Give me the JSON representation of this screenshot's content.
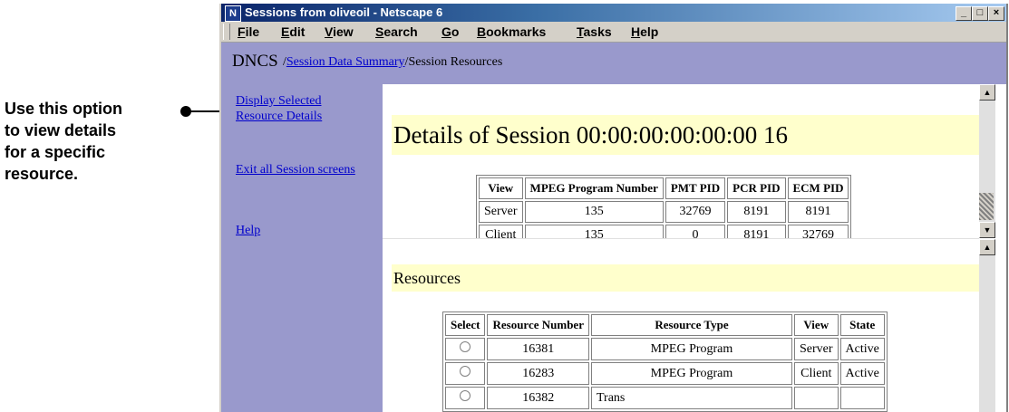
{
  "callout": {
    "text_lines": [
      "Use this option",
      "to view details",
      "for a specific",
      "resource."
    ]
  },
  "window": {
    "title": "Sessions from oliveoil - Netscape 6",
    "app_icon": "N",
    "buttons": {
      "minimize": "_",
      "maximize": "□",
      "close": "×"
    }
  },
  "menu": [
    "File",
    "Edit",
    "View",
    "Search",
    "Go",
    "Bookmarks",
    "Tasks",
    "Help"
  ],
  "breadcrumb": {
    "root": "DNCS",
    "sep1": "/",
    "link": "Session Data Summary",
    "sep2": "/",
    "current": "Session Resources"
  },
  "sidebar": {
    "display_selected": "Display Selected Resource Details",
    "exit_all": "Exit all Session screens",
    "help": "Help"
  },
  "details": {
    "heading": "Details of Session 00:00:00:00:00:00 16",
    "columns": [
      "View",
      "MPEG Program Number",
      "PMT PID",
      "PCR PID",
      "ECM PID"
    ],
    "rows": [
      [
        "Server",
        "135",
        "32769",
        "8191",
        "8191"
      ],
      [
        "Client",
        "135",
        "0",
        "8191",
        "32769"
      ]
    ]
  },
  "resources": {
    "heading": "Resources",
    "columns": [
      "Select",
      "Resource Number",
      "Resource Type",
      "View",
      "State"
    ],
    "rows": [
      [
        "",
        "16381",
        "MPEG Program",
        "Server",
        "Active"
      ],
      [
        "",
        "16283",
        "MPEG Program",
        "Client",
        "Active"
      ],
      [
        "",
        "16382",
        "Trans",
        "",
        ""
      ]
    ]
  },
  "colors": {
    "sidebar": "#9999cc",
    "heading_bg": "#ffffcc",
    "link": "#0000cc",
    "titlebar": "#0a246a"
  }
}
